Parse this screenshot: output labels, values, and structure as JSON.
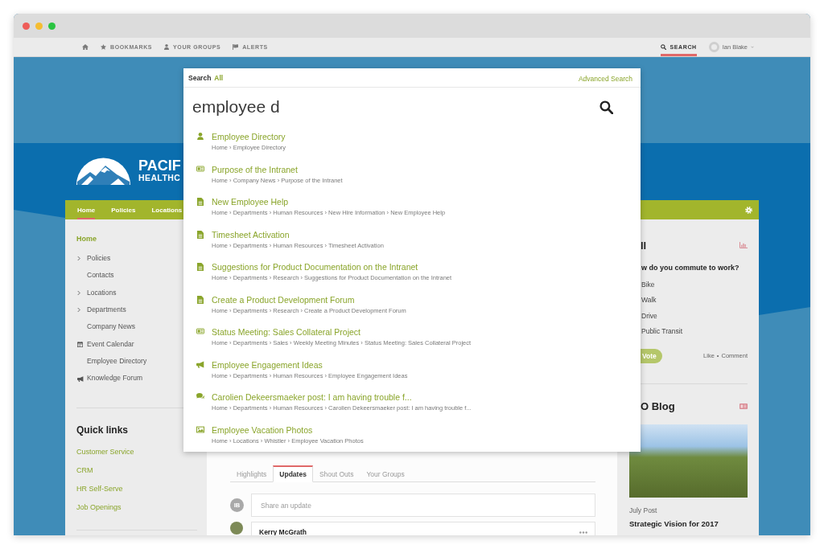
{
  "top_nav": {
    "items": [
      {
        "kind": "home",
        "selected": false
      },
      {
        "kind": "bookmarks",
        "label": "BOOKMARKS",
        "selected": false
      },
      {
        "kind": "groups",
        "label": "YOUR GROUPS",
        "selected": false
      },
      {
        "kind": "alerts",
        "label": "ALERTS",
        "selected": false
      }
    ],
    "search": {
      "label": "SEARCH",
      "selected": true
    },
    "user": {
      "name": "Ian Blake"
    }
  },
  "search": {
    "title": "Search",
    "scope": "All",
    "advanced_link": "Advanced Search",
    "value": "employee d",
    "results": [
      {
        "kind": "person",
        "title": "Employee Directory",
        "path": "Home › Employee Directory"
      },
      {
        "kind": "news",
        "title": "Purpose of the Intranet",
        "path": "Home › Company News › Purpose of the Intranet"
      },
      {
        "kind": "page",
        "title": "New Employee Help",
        "path": "Home › Departments › Human Resources › New Hire Information › New Employee Help"
      },
      {
        "kind": "page",
        "title": "Timesheet Activation",
        "path": "Home › Departments › Human Resources › Timesheet Activation"
      },
      {
        "kind": "page",
        "title": "Suggestions for Product Documentation on the Intranet",
        "path": "Home › Departments › Research › Suggestions for Product Documentation on the Intranet"
      },
      {
        "kind": "page",
        "title": "Create a Product Development Forum",
        "path": "Home › Departments › Research › Create a Product Development Forum"
      },
      {
        "kind": "news",
        "title": "Status Meeting: Sales Collateral Project",
        "path": "Home › Departments › Sales › Weekly Meeting Minutes › Status Meeting: Sales Collateral Project"
      },
      {
        "kind": "forum",
        "title": "Employee Engagement Ideas",
        "path": "Home › Departments › Human Resources › Employee Engagement Ideas"
      },
      {
        "kind": "post",
        "title": "Carolien Dekeersmaeker post: I am having trouble f...",
        "path": "Home › Departments › Human Resources › Carolien Dekeersmaeker post: I am having trouble f..."
      },
      {
        "kind": "photo",
        "title": "Employee Vacation Photos",
        "path": "Home › Locations › Whistler › Employee Vacation Photos"
      }
    ]
  },
  "logo": {
    "line_1": "PACIF",
    "line_2": "HEALTHC"
  },
  "main_nav": {
    "items": [
      {
        "label": "Home",
        "selected": true
      },
      {
        "label": "Policies",
        "selected": false
      },
      {
        "label": "Locations",
        "selected": false
      }
    ]
  },
  "sidebar": {
    "nav": [
      {
        "label": "Home",
        "selected": true,
        "children": [
          {
            "label": "Policies",
            "kind": "section",
            "selected": false
          },
          {
            "label": "Contacts",
            "kind": "page",
            "selected": false
          },
          {
            "label": "Locations",
            "kind": "section",
            "selected": false
          },
          {
            "label": "Departments",
            "kind": "section",
            "selected": false
          },
          {
            "label": "Company News",
            "kind": "page",
            "selected": false
          },
          {
            "label": "Event Calendar",
            "kind": "calendar",
            "selected": false
          },
          {
            "label": "Employee Directory",
            "kind": "page",
            "selected": false
          },
          {
            "label": "Knowledge Forum",
            "kind": "forum",
            "selected": false
          }
        ]
      }
    ],
    "quick_links": {
      "title": "Quick links",
      "items": [
        "Customer Service",
        "CRM",
        "HR Self-Serve",
        "Job Openings"
      ]
    }
  },
  "feed": {
    "tabs": [
      {
        "label": "Highlights",
        "selected": false
      },
      {
        "label": "Updates",
        "selected": true
      },
      {
        "label": "Shout Outs",
        "selected": false
      },
      {
        "label": "Your Groups",
        "selected": false
      }
    ],
    "composer": {
      "initials": "IB",
      "placeholder": "Share an update"
    },
    "posts": [
      {
        "author": "Kerry McGrath"
      }
    ]
  },
  "poll": {
    "title": "ll",
    "question": "w do you commute to work?",
    "options": [
      "Bike",
      "Walk",
      "Drive",
      "Public Transit"
    ],
    "vote": "Vote",
    "like": "Like",
    "separator": "•",
    "comment": "Comment"
  },
  "blog": {
    "title": "O Blog",
    "label": "July Post",
    "post_title": "Strategic Vision for 2017"
  }
}
